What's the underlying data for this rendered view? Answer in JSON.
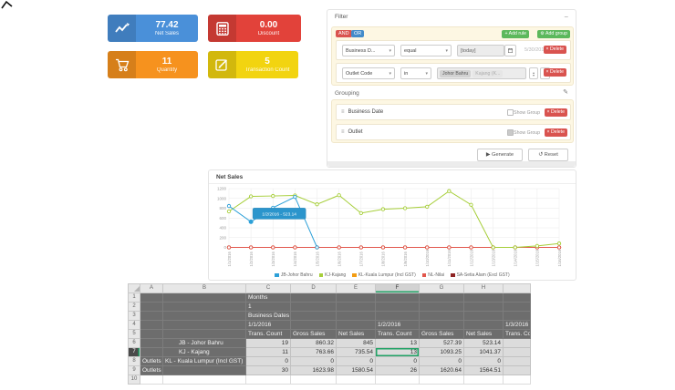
{
  "colors": {
    "kpi_blue": "#4a90d9",
    "kpi_red": "#e2423a",
    "kpi_orange": "#f6921e",
    "kpi_yellow": "#f2d410",
    "success_green": "#5cb85c",
    "danger_red": "#d9534f",
    "or_badge_blue": "#428bca",
    "excel_select_green": "#21a366",
    "tooltip_blue": "#2b95cc"
  },
  "kpi_cards": [
    {
      "value": "77.42",
      "label": "Net Sales"
    },
    {
      "value": "0.00",
      "label": "Discount"
    },
    {
      "value": "11",
      "label": "Quantity"
    },
    {
      "value": "5",
      "label": "Transaction Count"
    }
  ],
  "filter": {
    "title": "Filter",
    "collapse": "−",
    "and_badge": "AND",
    "or_badge": "OR",
    "add_rule": "+ Add rule",
    "add_group": "⚙ Add group",
    "delete_label": "× Delete",
    "rules": [
      {
        "field": "Business D...",
        "operator": "equal",
        "value": "[today]",
        "hint": "5/30/2018"
      },
      {
        "field": "Outlet Code",
        "operator": "in",
        "chips": [
          "Johor Bahru",
          "Kajang (K..."
        ]
      }
    ],
    "grouping": {
      "title": "Grouping",
      "rows": [
        {
          "label": "Business Date",
          "show_label": "Show Group"
        },
        {
          "label": "Outlet",
          "show_label": "Show Group"
        }
      ]
    },
    "generate": "▶ Generate",
    "reset": "↺ Reset"
  },
  "chart_data": {
    "type": "line",
    "title": "Net Sales",
    "x": [
      "1/1/2016",
      "1/2/2016",
      "1/3/2016",
      "1/4/2016",
      "1/5/2016",
      "1/6/2016",
      "1/7/2016",
      "1/8/2016",
      "1/9/2016",
      "1/10/2016",
      "1/11/2016",
      "1/12/2016",
      "1/13/2016",
      "1/14/2016",
      "1/15/2016",
      "1/16/2016"
    ],
    "ylim": [
      0,
      1200
    ],
    "yticks": [
      0,
      200,
      400,
      600,
      800,
      1000,
      1200
    ],
    "grid": true,
    "legend_position": "bottom",
    "series": [
      {
        "name": "JB-Johor Bahru",
        "color": "#2da0d8",
        "values": [
          845,
          523.14,
          810,
          1030,
          0,
          null,
          null,
          null,
          null,
          null,
          null,
          null,
          null,
          null,
          null,
          null
        ]
      },
      {
        "name": "KJ-Kajang",
        "color": "#a6ce39",
        "values": [
          735.54,
          1041.37,
          1050,
          1060,
          880,
          1065,
          700,
          780,
          800,
          830,
          1150,
          870,
          0,
          0,
          30,
          80
        ]
      },
      {
        "name": "KL-Kuala Lumpur (Incl GST)",
        "color": "#f39c12",
        "values": [
          0,
          0,
          0,
          0,
          0,
          0,
          0,
          0,
          0,
          0,
          0,
          0,
          0,
          0,
          0,
          0
        ]
      },
      {
        "name": "NL-Nilai",
        "color": "#e2574c",
        "values": [
          0,
          0,
          0,
          0,
          0,
          0,
          0,
          0,
          0,
          0,
          0,
          0,
          0,
          0,
          0,
          0
        ]
      },
      {
        "name": "SA-Setia Alam (Excl GST)",
        "color": "#8e2323",
        "values": [
          0,
          0,
          0,
          0,
          0,
          0,
          0,
          0,
          0,
          0,
          0,
          0,
          0,
          0,
          0,
          0
        ]
      }
    ],
    "tooltip": {
      "text": "1/2/2016 - 523.14",
      "series_index": 0,
      "point_index": 1,
      "value": 523.14
    }
  },
  "spreadsheet": {
    "col_headers": [
      "A",
      "B",
      "C",
      "D",
      "E",
      "F",
      "G",
      "H",
      ""
    ],
    "selected_col_index": 5,
    "selected_row": 7,
    "rows": [
      {
        "n": "1",
        "cells": [
          "",
          "",
          "Months",
          "",
          "",
          "",
          "",
          "",
          ""
        ]
      },
      {
        "n": "2",
        "cells": [
          "",
          "",
          "1",
          "",
          "",
          "",
          "",
          "",
          ""
        ]
      },
      {
        "n": "3",
        "cells": [
          "",
          "",
          "Business Dates",
          "",
          "",
          "",
          "",
          "",
          ""
        ]
      },
      {
        "n": "4",
        "cells": [
          "",
          "",
          "1/1/2016",
          "",
          "",
          "1/2/2016",
          "",
          "",
          "1/3/2016"
        ]
      },
      {
        "n": "5",
        "cells": [
          "",
          "",
          "Trans. Count",
          "Gross Sales",
          "Net Sales",
          "Trans. Count",
          "Gross Sales",
          "Net Sales",
          "Trans. Count"
        ]
      },
      {
        "n": "6",
        "cells": [
          "",
          "JB - Johor Bahru",
          "19",
          "860.32",
          "845",
          "13",
          "527.39",
          "523.14",
          ""
        ]
      },
      {
        "n": "7",
        "cells": [
          "",
          "KJ - Kajang",
          "11",
          "763.66",
          "735.54",
          "13",
          "1093.25",
          "1041.37",
          ""
        ]
      },
      {
        "n": "8",
        "cells": [
          "Outlets",
          "KL - Kuala Lumpur (Incl GST)",
          "0",
          "0",
          "0",
          "0",
          "0",
          "0",
          ""
        ]
      },
      {
        "n": "9",
        "cells": [
          "Outlets",
          "",
          "30",
          "1623.98",
          "1580.54",
          "26",
          "1620.64",
          "1564.51",
          ""
        ]
      },
      {
        "n": "10",
        "cells": [
          "",
          "",
          "",
          "",
          "",
          "",
          "",
          "",
          ""
        ]
      }
    ]
  }
}
